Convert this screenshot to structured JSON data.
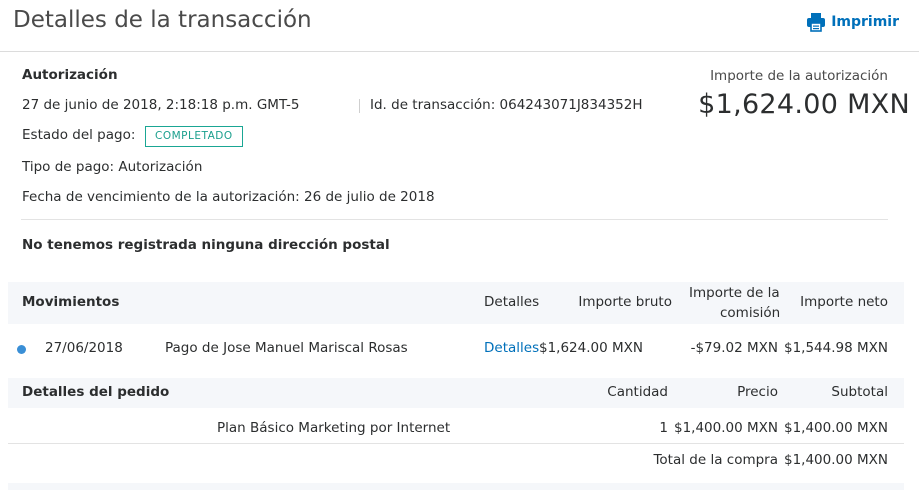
{
  "header": {
    "title": "Detalles de la transacción",
    "print_label": "Imprimir",
    "print_icon": "printer-icon",
    "accent_color": "#0070ba"
  },
  "summary": {
    "type_label": "Autorización",
    "datetime": "27 de junio de 2018, 2:18:18 p.m. GMT-5",
    "transaction_id": "Id. de transacción: 064243071J834352H",
    "status_label": "Estado del pago:",
    "status_badge": "COMPLETADO",
    "payment_type": "Tipo de pago: Autorización",
    "expiry": "Fecha de vencimiento de la autorización: 26 de julio de 2018",
    "no_address": "No tenemos registrada ninguna dirección postal",
    "auth_amount_label": "Importe de la autorización",
    "auth_amount": "$1,624.00 MXN"
  },
  "movements": {
    "headers": {
      "title": "Movimientos",
      "details": "Detalles",
      "gross": "Importe bruto",
      "fee_line1": "Importe de la",
      "fee_line2": "comisión",
      "net": "Importe neto"
    },
    "rows": [
      {
        "date": "27/06/2018",
        "description": "Pago de Jose Manuel Mariscal Rosas",
        "details_link": "Detalles",
        "gross": "$1,624.00 MXN",
        "fee": "-$79.02 MXN",
        "net": "$1,544.98 MXN"
      }
    ]
  },
  "order": {
    "headers": {
      "title": "Detalles del pedido",
      "quantity": "Cantidad",
      "price": "Precio",
      "subtotal": "Subtotal"
    },
    "items": [
      {
        "name": "Plan Básico Marketing por Internet",
        "quantity": "1",
        "price": "$1,400.00 MXN",
        "subtotal": "$1,400.00 MXN"
      }
    ],
    "total_label": "Total de la compra",
    "total": "$1,400.00 MXN"
  }
}
